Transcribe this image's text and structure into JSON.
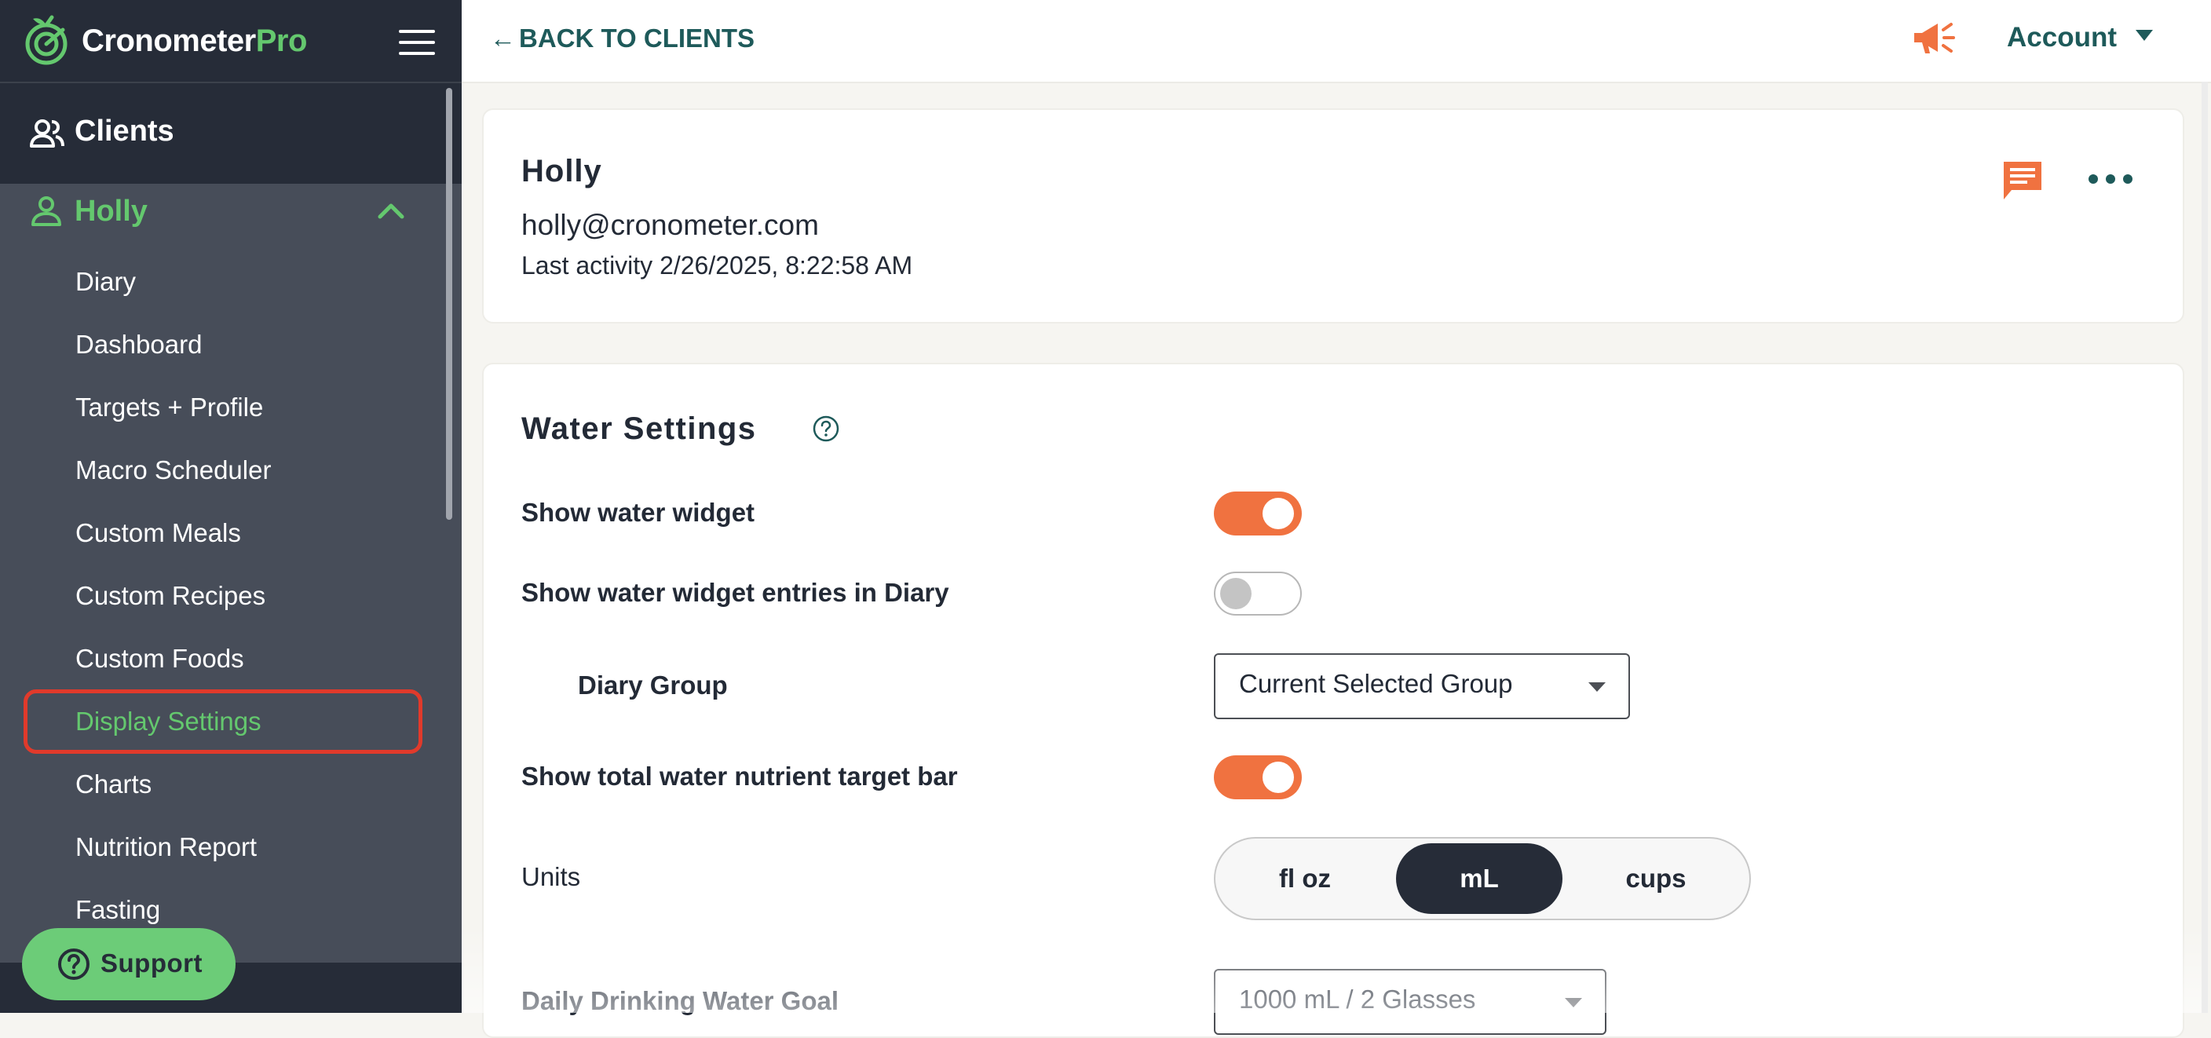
{
  "sidebar": {
    "brand": "Cronometer",
    "brand_suffix": "Pro",
    "clients_label": "Clients",
    "client_name": "Holly",
    "items": [
      {
        "label": "Diary"
      },
      {
        "label": "Dashboard"
      },
      {
        "label": "Targets + Profile"
      },
      {
        "label": "Macro Scheduler"
      },
      {
        "label": "Custom Meals"
      },
      {
        "label": "Custom Recipes"
      },
      {
        "label": "Custom Foods"
      },
      {
        "label": "Display Settings",
        "active": true
      },
      {
        "label": "Charts"
      },
      {
        "label": "Nutrition Report"
      },
      {
        "label": "Fasting"
      }
    ],
    "support_label": "Support"
  },
  "topbar": {
    "back_label": "BACK TO CLIENTS",
    "account_label": "Account"
  },
  "client": {
    "name": "Holly",
    "email": "holly@cronometer.com",
    "last_activity": "Last activity 2/26/2025, 8:22:58 AM"
  },
  "water_settings": {
    "title": "Water Settings",
    "show_widget": {
      "label": "Show water widget",
      "on": true
    },
    "show_entries": {
      "label": "Show water widget entries in Diary",
      "on": false
    },
    "diary_group": {
      "label": "Diary Group",
      "value": "Current Selected Group"
    },
    "show_target_bar": {
      "label": "Show total water nutrient target bar",
      "on": true
    },
    "units": {
      "label": "Units",
      "options": [
        "fl oz",
        "mL",
        "cups"
      ],
      "selected": "mL"
    },
    "daily_goal": {
      "label": "Daily Drinking Water Goal",
      "value": "1000 mL / 2 Glasses"
    }
  },
  "colors": {
    "accent_green": "#64c86e",
    "accent_orange": "#f07240",
    "sidebar_dark": "#262c38",
    "sidebar_mid": "#474d59",
    "link_teal": "#1e5a5a",
    "highlight_red": "#e13a2b"
  }
}
